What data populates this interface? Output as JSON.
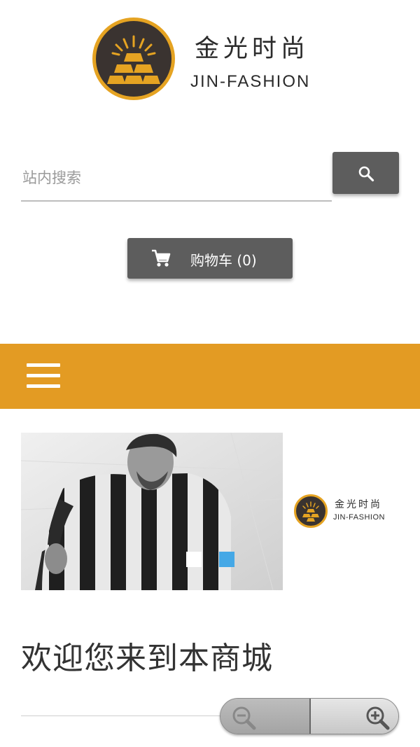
{
  "header": {
    "brand_cn": "金光时尚",
    "brand_en": "JIN-FASHION",
    "logo_icon": "gold-bars-sunburst-icon"
  },
  "search": {
    "placeholder": "站内搜索",
    "button_icon": "search-icon"
  },
  "cart": {
    "label": "购物车 (0)",
    "icon": "shopping-cart-icon"
  },
  "nav": {
    "menu_icon": "hamburger-menu-icon",
    "bar_color": "#e39b23"
  },
  "banner": {
    "brand_cn": "金光时尚",
    "brand_en": "JIN-FASHION",
    "slide_dots": 2,
    "active_dot_color": "#45a8e6"
  },
  "welcome": {
    "heading": "欢迎您来到本商城"
  },
  "zoom": {
    "zoom_out_icon": "zoom-out-icon",
    "zoom_in_icon": "zoom-in-icon"
  },
  "colors": {
    "accent": "#e39b23",
    "button_bg": "#5d5d5d",
    "logo_dark": "#3a3330"
  }
}
